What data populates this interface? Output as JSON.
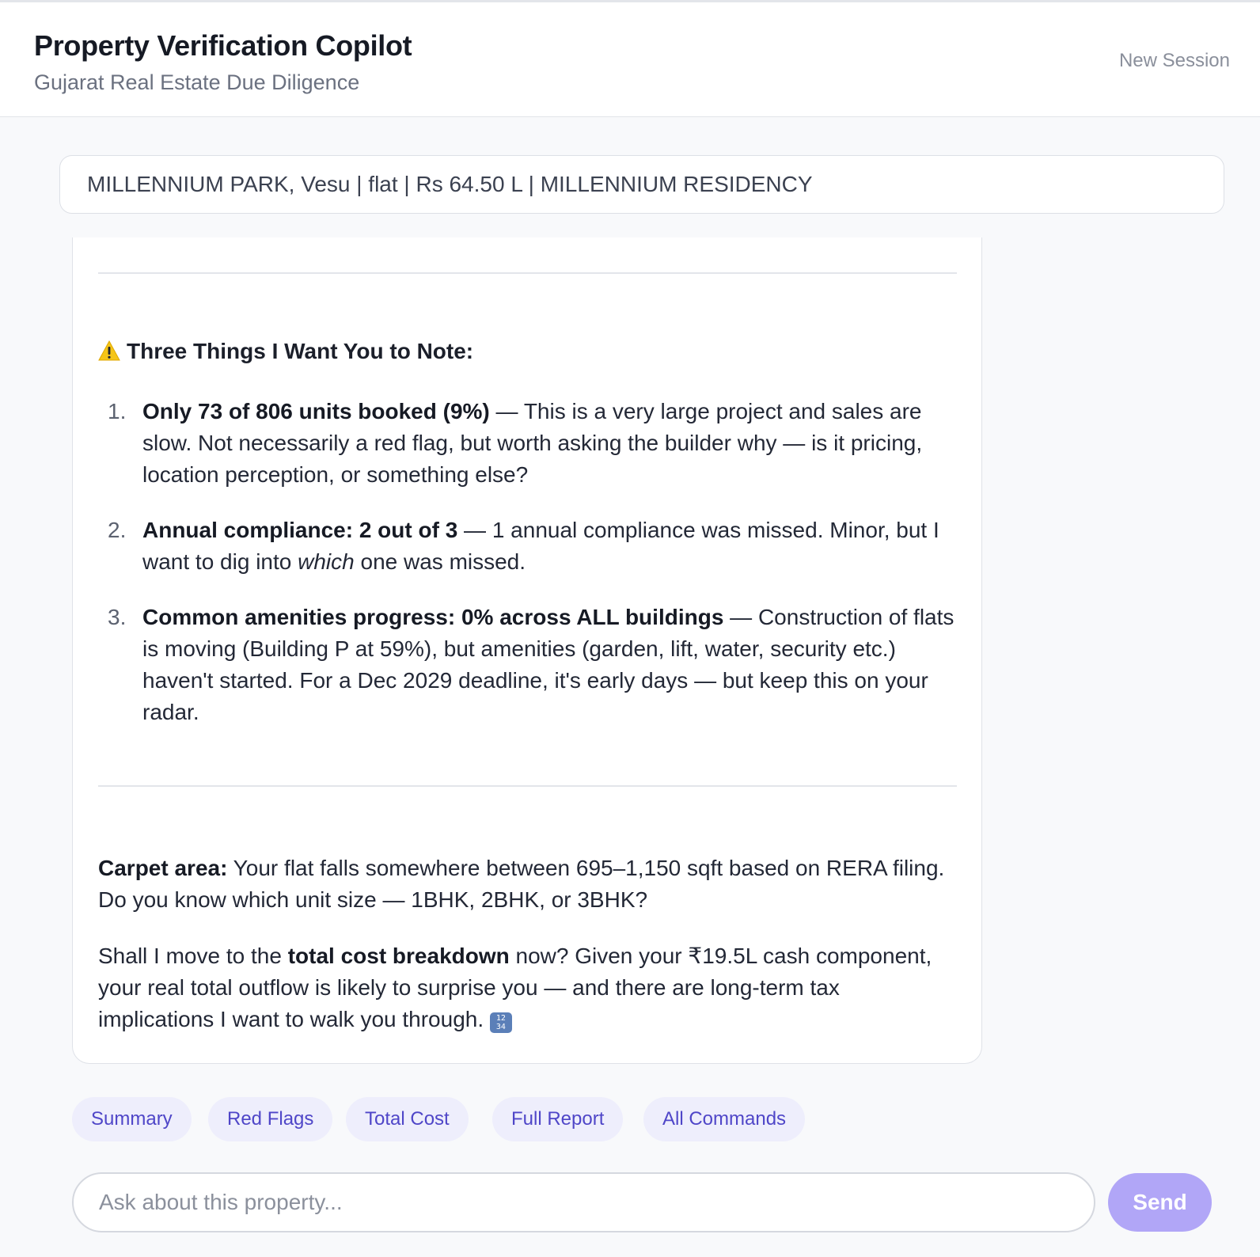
{
  "header": {
    "title": "Property Verification Copilot",
    "subtitle": "Gujarat Real Estate Due Diligence",
    "new_session_label": "New Session"
  },
  "context_bar": {
    "text": "MILLENNIUM PARK, Vesu | flat | Rs 64.50 L | MILLENNIUM RESIDENCY"
  },
  "message": {
    "heading": "Three Things I Want You to Note:",
    "items": [
      {
        "number": "1.",
        "bold": "Only 73 of 806 units booked (9%)",
        "text": " — This is a very large project and sales are slow. Not necessarily a red flag, but worth asking the builder why — is it pricing, location perception, or something else?"
      },
      {
        "number": "2.",
        "bold": "Annual compliance: 2 out of 3",
        "text_before": " — 1 annual compliance was missed. Minor, but I want to dig into ",
        "italic": "which",
        "text_after": " one was missed."
      },
      {
        "number": "3.",
        "bold": "Common amenities progress: 0% across ALL buildings",
        "text": " — Construction of flats is moving (Building P at 59%), but amenities (garden, lift, water, security etc.) haven't started. For a Dec 2029 deadline, it's early days — but keep this on your radar."
      }
    ],
    "carpet": {
      "bold": "Carpet area:",
      "text": " Your flat falls somewhere between 695–1,150 sqft based on RERA filing. Do you know which unit size — 1BHK, 2BHK, or 3BHK?"
    },
    "closing": {
      "text_before": "Shall I move to the ",
      "bold": "total cost breakdown",
      "text_after": " now? Given your ₹19.5L cash component, your real total outflow is likely to surprise you — and there are long-term tax implications I want to walk you through. "
    }
  },
  "quick_actions": [
    "Summary",
    "Red Flags",
    "Total Cost",
    "Full Report",
    "All Commands"
  ],
  "composer": {
    "placeholder": "Ask about this property...",
    "send_label": "Send"
  },
  "colors": {
    "accent": "#4f46c8",
    "chip_bg": "#eeeefc",
    "send_bg": "#b1a6f7"
  }
}
